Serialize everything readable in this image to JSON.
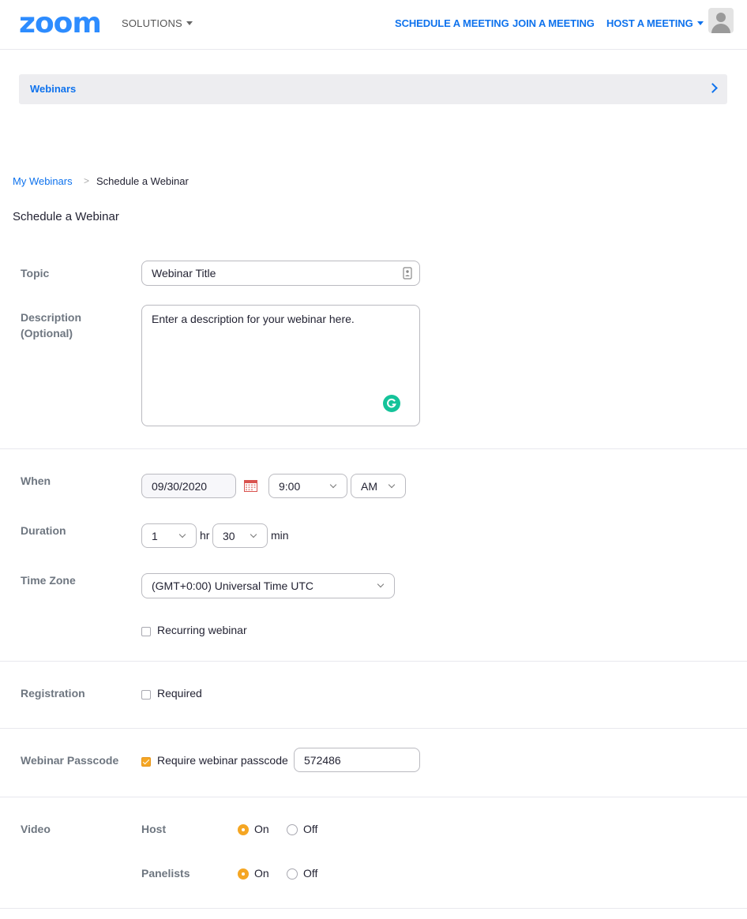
{
  "header": {
    "logo": "zoom",
    "solutions": "SOLUTIONS",
    "schedule": "SCHEDULE A MEETING",
    "join": "JOIN A MEETING",
    "host": "HOST A MEETING"
  },
  "subnav": {
    "label": "Webinars"
  },
  "breadcrumb": {
    "parent": "My Webinars",
    "separator": ">",
    "current": "Schedule a Webinar"
  },
  "page_title": "Schedule a Webinar",
  "form": {
    "topic": {
      "label": "Topic",
      "value": "Webinar Title"
    },
    "description": {
      "label_line1": "Description",
      "label_line2": "(Optional)",
      "value": "Enter a description for your webinar here."
    },
    "when": {
      "label": "When",
      "date": "09/30/2020",
      "time": "9:00",
      "ampm": "AM"
    },
    "duration": {
      "label": "Duration",
      "hours": "1",
      "hr_unit": "hr",
      "minutes": "30",
      "min_unit": "min"
    },
    "timezone": {
      "label": "Time Zone",
      "value": "(GMT+0:00) Universal Time UTC"
    },
    "recurring": {
      "label": "Recurring webinar",
      "checked": false
    },
    "registration": {
      "label": "Registration",
      "option": "Required",
      "checked": false
    },
    "passcode": {
      "label": "Webinar Passcode",
      "option": "Require webinar passcode",
      "checked": true,
      "value": "572486"
    },
    "video": {
      "label": "Video",
      "host": {
        "label": "Host",
        "on": "On",
        "off": "Off",
        "selected": "On"
      },
      "panelists": {
        "label": "Panelists",
        "on": "On",
        "off": "Off",
        "selected": "On"
      }
    }
  },
  "colors": {
    "brand": "#2d8cff",
    "link": "#0e72ed",
    "accent": "#f5a623",
    "grammarly": "#15c39a"
  },
  "icons": [
    "user-avatar-icon",
    "chevron-right-icon",
    "chevron-down-icon",
    "calendar-icon",
    "contact-card-icon",
    "grammarly-icon"
  ]
}
